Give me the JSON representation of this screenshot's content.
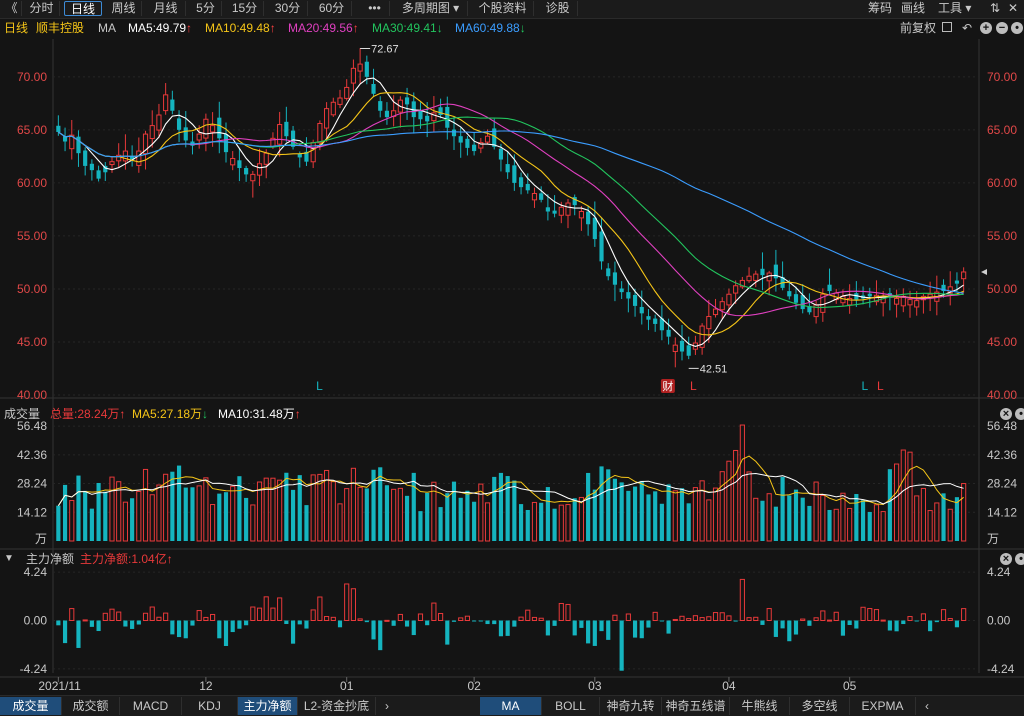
{
  "toolbar": {
    "back_glyph": "《",
    "tabs": [
      "分时",
      "日线",
      "周线",
      "月线",
      "5分",
      "15分",
      "30分",
      "60分",
      "•••",
      "多周期图 ▾",
      "个股资料",
      "诊股"
    ],
    "active_tab": 1,
    "right": [
      "筹码",
      "画线",
      "工具 ▾"
    ],
    "window_controls": [
      "⇅",
      "✕"
    ]
  },
  "legend": {
    "period": "日线",
    "stock_name": "顺丰控股",
    "ma_label": "MA",
    "ma_items": [
      {
        "text": "MA5:49.79",
        "arrow": "↑",
        "color": "#ffffff",
        "arrow_color": "#ff4040"
      },
      {
        "text": "MA10:49.48",
        "arrow": "↑",
        "color": "#f5c518",
        "arrow_color": "#ff4040"
      },
      {
        "text": "MA20:49.56",
        "arrow": "↑",
        "color": "#e040c0",
        "arrow_color": "#ff4040"
      },
      {
        "text": "MA30:49.41",
        "arrow": "↓",
        "color": "#22c55e",
        "arrow_color": "#22c55e"
      },
      {
        "text": "MA60:49.88",
        "arrow": "↓",
        "color": "#3b9dff",
        "arrow_color": "#22c55e"
      }
    ],
    "right_label": "前复权"
  },
  "vol_legend": {
    "title": "成交量",
    "total": "总量:28.24万",
    "total_arrow": "↑",
    "ma5": "MA5:27.18万",
    "ma5_arrow": "↓",
    "ma10": "MA10:31.48万",
    "ma10_arrow": "↑"
  },
  "flow_legend": {
    "toggle": "▼",
    "title": "主力净额",
    "value": "主力净额:1.04亿",
    "arrow": "↑"
  },
  "colors": {
    "up": "#e8393a",
    "down": "#15b4bf",
    "ma5": "#ffffff",
    "ma10": "#f5c518",
    "ma20": "#e040c0",
    "ma30": "#22c55e",
    "ma60": "#3b9dff",
    "axis_text": "#e04848"
  },
  "chart_data": [
    {
      "type": "candlestick",
      "title": "",
      "y_ticks": [
        40.0,
        45.0,
        50.0,
        55.0,
        60.0,
        65.0,
        70.0
      ],
      "ylim": [
        40,
        73
      ],
      "annotations": {
        "high": "72.67",
        "low": "42.51"
      },
      "markers": [
        {
          "text": "L",
          "at": 0.29,
          "color": "#15b4bf"
        },
        {
          "text": "财",
          "at": 0.672,
          "color": "#ffffff",
          "badge": true
        },
        {
          "text": "L",
          "at": 0.7,
          "color": "#e8393a"
        },
        {
          "text": "L",
          "at": 0.888,
          "color": "#15b4bf"
        },
        {
          "text": "L",
          "at": 0.905,
          "color": "#e8393a"
        }
      ],
      "x_ticks": [
        "2021/11",
        "12",
        "01",
        "02",
        "03",
        "04",
        "05"
      ],
      "x_tick_index": [
        0,
        22,
        43,
        62,
        80,
        100,
        118
      ],
      "close": [
        64.8,
        63.9,
        64.5,
        62.8,
        61.6,
        61.2,
        60.4,
        61.0,
        62.0,
        62.6,
        63.0,
        62.2,
        63.0,
        64.6,
        65.4,
        66.4,
        68.3,
        66.8,
        65.0,
        64.0,
        63.5,
        64.6,
        66.0,
        65.4,
        64.2,
        62.9,
        62.3,
        61.4,
        60.8,
        60.8,
        61.8,
        62.8,
        64.2,
        65.5,
        64.4,
        63.4,
        62.4,
        62.0,
        63.8,
        65.6,
        67.0,
        67.6,
        68.0,
        69.0,
        70.8,
        71.2,
        70.0,
        68.4,
        66.8,
        66.2,
        66.8,
        67.8,
        67.4,
        66.2,
        66.0,
        65.8,
        66.6,
        66.4,
        65.2,
        64.4,
        63.8,
        63.3,
        63.0,
        63.8,
        64.4,
        63.4,
        62.2,
        61.0,
        60.0,
        59.6,
        59.3,
        59.0,
        58.4,
        57.3,
        57.1,
        57.7,
        58.1,
        57.9,
        57.3,
        56.1,
        54.7,
        52.6,
        51.2,
        50.4,
        49.7,
        49.1,
        48.4,
        47.7,
        47.1,
        46.7,
        46.1,
        45.5,
        44.7,
        44.1,
        43.7,
        44.9,
        46.5,
        47.4,
        48.1,
        48.8,
        49.5,
        50.3,
        50.8,
        51.2,
        51.4,
        51.3,
        51.5,
        51.0,
        50.1,
        49.3,
        48.7,
        48.1,
        47.8,
        48.5,
        49.5,
        49.8,
        49.6,
        49.3,
        49.1,
        49.0,
        49.1,
        49.3,
        49.4,
        49.3,
        49.2,
        49.1,
        49.3,
        49.0,
        48.9,
        49.3,
        49.5,
        49.7,
        49.8,
        50.2,
        50.5,
        51.6
      ],
      "ma5_last": 49.79,
      "ma10_last": 49.48,
      "ma20_last": 49.56,
      "ma30_last": 49.41,
      "ma60_last": 49.88
    },
    {
      "type": "bar",
      "title": "成交量",
      "unit_label": "万",
      "y_ticks": [
        14.12,
        28.24,
        42.36,
        56.48
      ],
      "ylim": [
        0,
        58
      ],
      "last_value": 28.24,
      "ma5_last": 27.18,
      "ma10_last": 31.48
    },
    {
      "type": "bar",
      "title": "主力净额",
      "y_ticks": [
        -4.24,
        0.0,
        4.24
      ],
      "ylim": [
        -4.6,
        4.6
      ],
      "last_value": 1.04
    }
  ],
  "bottom_tabs": {
    "left": [
      "成交量",
      "成交额",
      "MACD",
      "KDJ",
      "主力净额",
      "L2-资金抄底",
      "›"
    ],
    "right": [
      "MA",
      "BOLL",
      "神奇九转",
      "神奇五线谱",
      "牛熊线",
      "多空线",
      "EXPMA",
      "‹"
    ],
    "left_active": [
      0,
      4
    ],
    "right_active": [
      0
    ]
  }
}
